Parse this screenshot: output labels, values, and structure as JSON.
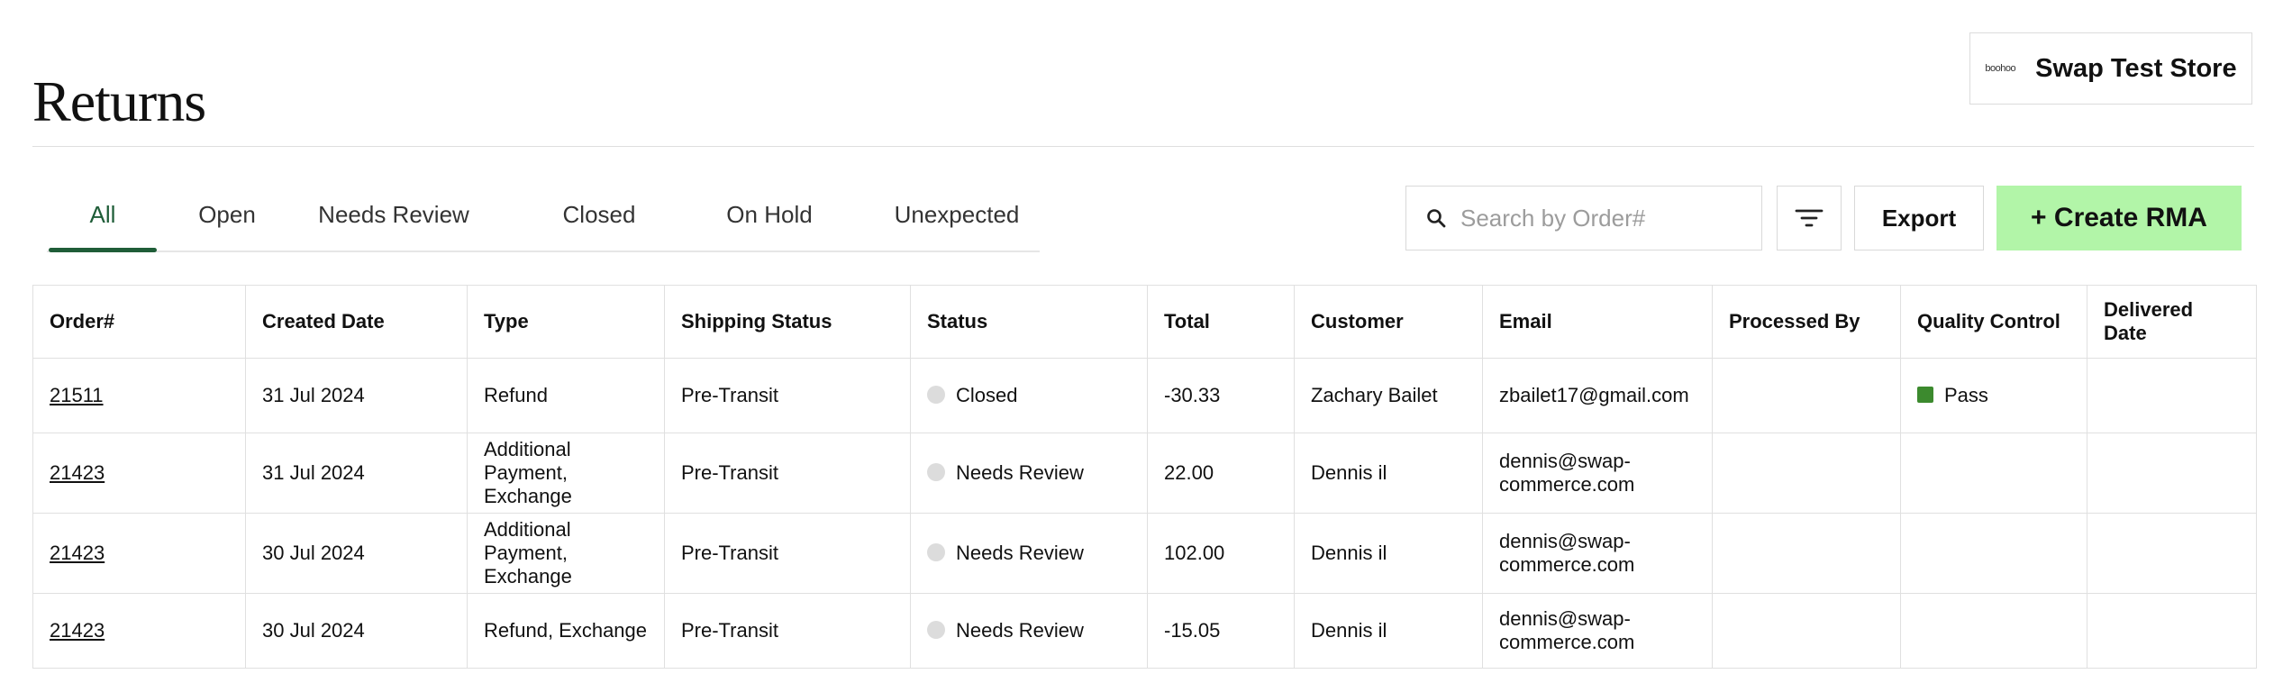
{
  "page": {
    "title": "Returns"
  },
  "store": {
    "logo_text": "boohoo",
    "name": "Swap Test Store"
  },
  "tabs": [
    {
      "label": "All",
      "active": true
    },
    {
      "label": "Open",
      "active": false
    },
    {
      "label": "Needs Review",
      "active": false
    },
    {
      "label": "Closed",
      "active": false
    },
    {
      "label": "On Hold",
      "active": false
    },
    {
      "label": "Unexpected",
      "active": false
    }
  ],
  "search": {
    "placeholder": "Search by Order#",
    "value": ""
  },
  "toolbar": {
    "export_label": "Export",
    "create_label": "+ Create RMA"
  },
  "colors": {
    "accent": "#1f5d38",
    "create_button": "#b2f5a8",
    "status_dot": "#dcdcdc",
    "qc_pass": "#3c8a2e"
  },
  "table": {
    "columns": [
      "Order#",
      "Created Date",
      "Type",
      "Shipping Status",
      "Status",
      "Total",
      "Customer",
      "Email",
      "Processed By",
      "Quality Control",
      "Delivered Date"
    ],
    "rows": [
      {
        "order": "21511",
        "created": "31 Jul 2024",
        "type": "Refund",
        "shipping": "Pre-Transit",
        "status": "Closed",
        "total": "-30.33",
        "customer": "Zachary Bailet",
        "email": "zbailet17@gmail.com",
        "processed_by": "",
        "qc": "Pass",
        "delivered": ""
      },
      {
        "order": "21423",
        "created": "31 Jul 2024",
        "type": "Additional Payment, Exchange",
        "shipping": "Pre-Transit",
        "status": "Needs Review",
        "total": "22.00",
        "customer": "Dennis il",
        "email": "dennis@swap-commerce.com",
        "processed_by": "",
        "qc": "",
        "delivered": ""
      },
      {
        "order": "21423",
        "created": "30 Jul 2024",
        "type": "Additional Payment, Exchange",
        "shipping": "Pre-Transit",
        "status": "Needs Review",
        "total": "102.00",
        "customer": "Dennis il",
        "email": "dennis@swap-commerce.com",
        "processed_by": "",
        "qc": "",
        "delivered": ""
      },
      {
        "order": "21423",
        "created": "30 Jul 2024",
        "type": "Refund, Exchange",
        "shipping": "Pre-Transit",
        "status": "Needs Review",
        "total": "-15.05",
        "customer": "Dennis il",
        "email": "dennis@swap-commerce.com",
        "processed_by": "",
        "qc": "",
        "delivered": ""
      }
    ]
  }
}
